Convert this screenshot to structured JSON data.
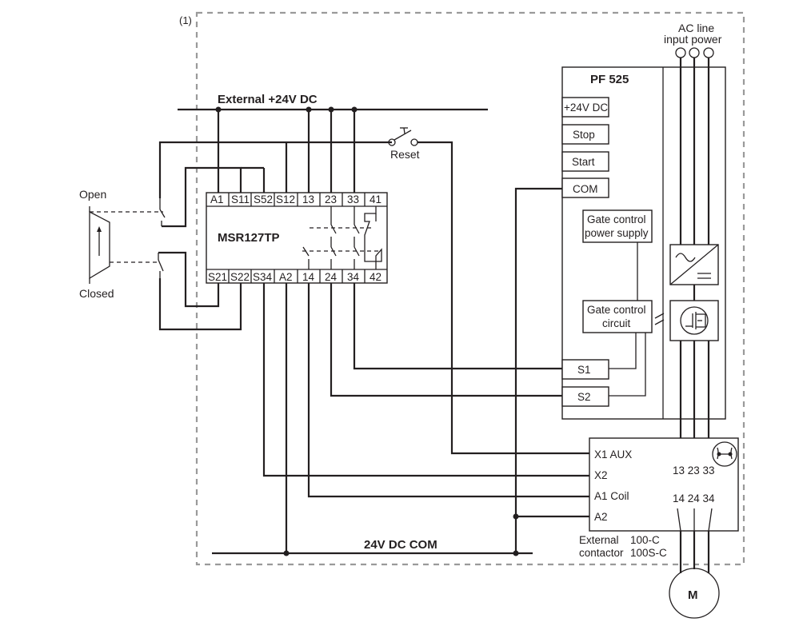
{
  "diagram": {
    "note_marker": "(1)",
    "buses": {
      "supply": "External +24V DC",
      "common": "24V DC COM"
    },
    "reset_switch": "Reset",
    "door_switch": {
      "open_label": "Open",
      "closed_label": "Closed"
    },
    "safety_relay": {
      "model": "MSR127TP",
      "top_terminals": [
        "A1",
        "S11",
        "S52",
        "S12",
        "13",
        "23",
        "33",
        "41"
      ],
      "bottom_terminals": [
        "S21",
        "S22",
        "S34",
        "A2",
        "14",
        "24",
        "34",
        "42"
      ]
    },
    "drive": {
      "model": "PF 525",
      "terminals": [
        "+24V DC",
        "Stop",
        "Start",
        "COM"
      ],
      "gate_supply": [
        "Gate control",
        "power supply"
      ],
      "gate_circuit": [
        "Gate control",
        "circuit"
      ],
      "safety_inputs": [
        "S1",
        "S2"
      ],
      "ac_input": [
        "AC line",
        "input power"
      ]
    },
    "contactor": {
      "inputs": [
        "X1 AUX",
        "X2",
        "A1 Coil",
        "A2"
      ],
      "line_terminals": "13 23 33",
      "load_terminals": "14 24 34",
      "caption_left": [
        "External",
        "contactor"
      ],
      "caption_right": [
        "100-C",
        "100S-C"
      ]
    },
    "motor": "M"
  }
}
